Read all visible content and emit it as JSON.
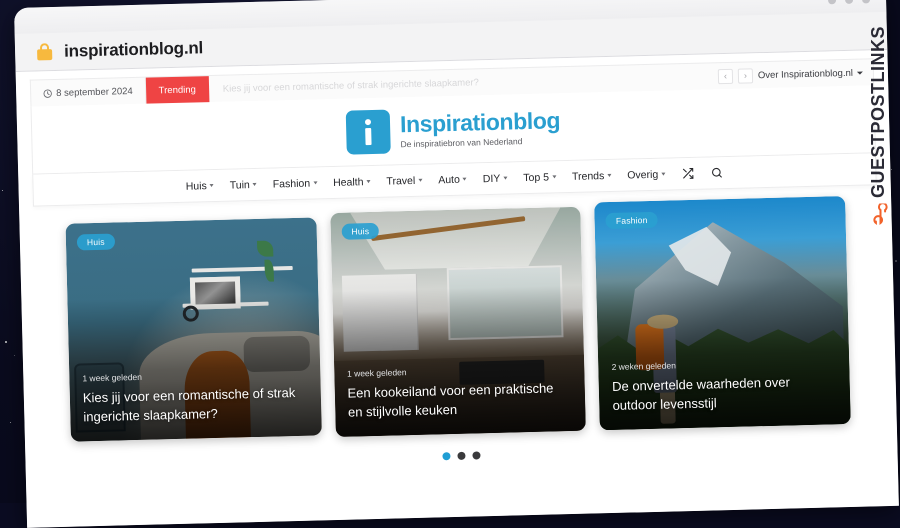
{
  "browser": {
    "url": "inspirationblog.nl",
    "lock_icon": "lock-icon",
    "window_dots": 3
  },
  "site": {
    "topbar": {
      "clock_icon": "clock-icon",
      "date": "8 september 2024",
      "trending_label": "Trending",
      "ticker_text": "Kies jij voor een romantische of strak ingerichte slaapkamer?",
      "prev_label": "‹",
      "next_label": "›",
      "about_label": "Over Inspirationblog.nl"
    },
    "brand": {
      "logo_letter": "i",
      "name": "Inspirationblog",
      "tagline": "De inspiratiebron van Nederland",
      "accent_color": "#2a9fd0"
    },
    "nav": {
      "items": [
        {
          "label": "Huis",
          "has_dropdown": true
        },
        {
          "label": "Tuin",
          "has_dropdown": true
        },
        {
          "label": "Fashion",
          "has_dropdown": true
        },
        {
          "label": "Health",
          "has_dropdown": true
        },
        {
          "label": "Travel",
          "has_dropdown": true
        },
        {
          "label": "Auto",
          "has_dropdown": true
        },
        {
          "label": "DIY",
          "has_dropdown": true
        },
        {
          "label": "Top 5",
          "has_dropdown": true
        },
        {
          "label": "Trends",
          "has_dropdown": true
        },
        {
          "label": "Overig",
          "has_dropdown": true
        }
      ],
      "shuffle_icon": "shuffle-icon",
      "search_icon": "search-icon"
    },
    "carousel": {
      "cards": [
        {
          "badge": "Huis",
          "meta": "1 week geleden",
          "title": "Kies jij voor een romantische of strak ingerichte slaapkamer?",
          "photo": "bedroom-blue-wall"
        },
        {
          "badge": "Huis",
          "meta": "1 week geleden",
          "title": "Een kookeiland voor een praktische en stijlvolle keuken",
          "photo": "modern-kitchen-island"
        },
        {
          "badge": "Fashion",
          "meta": "2 weken geleden",
          "title": "De onvertelde waarheden over outdoor levensstijl",
          "photo": "hiker-mountain"
        }
      ],
      "dots": [
        {
          "active": true
        },
        {
          "active": false
        },
        {
          "active": false
        }
      ]
    }
  },
  "watermark": {
    "text": "GUESTPOSTLINKS",
    "icon": "link-chain-icon",
    "icon_color": "#f2622a",
    "text_color": "#2a2a35"
  }
}
